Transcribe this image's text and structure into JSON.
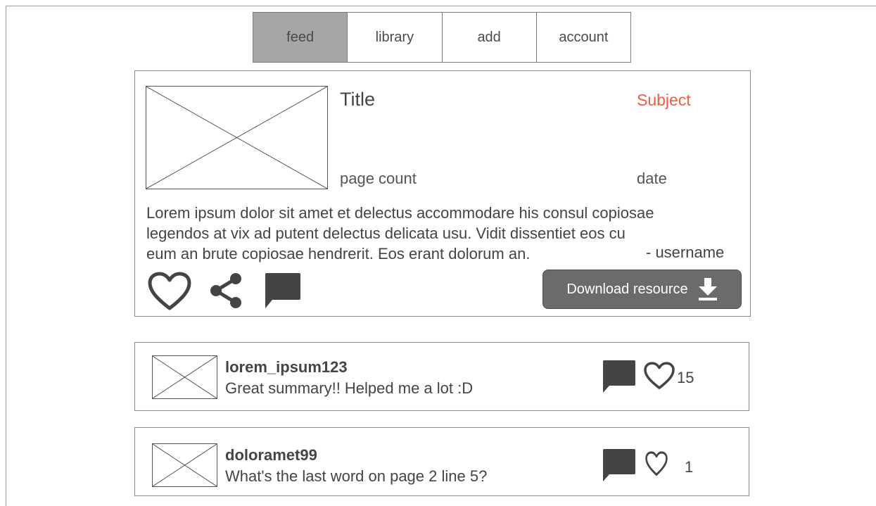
{
  "nav": {
    "tabs": [
      {
        "label": "feed",
        "active": true
      },
      {
        "label": "library",
        "active": false
      },
      {
        "label": "add",
        "active": false
      },
      {
        "label": "account",
        "active": false
      }
    ]
  },
  "resource": {
    "title": "Title",
    "subject": "Subject",
    "page_count": "page count",
    "date": "date",
    "description_lines": [
      "Lorem ipsum dolor sit amet et delectus accommodare his consul copiosae",
      "legendos at vix ad putent delectus delicata usu. Vidit dissentiet eos cu",
      "eum an brute copiosae hendrerit. Eos erant dolorum an."
    ],
    "username": "- username",
    "download_label": "Download resource",
    "icons": {
      "like": "heart-icon",
      "share": "share-icon",
      "comment": "comment-icon",
      "download": "download-icon"
    }
  },
  "comments": [
    {
      "username": "lorem_ipsum123",
      "text": "Great summary!! Helped me a lot :D",
      "likes": "15"
    },
    {
      "username": "doloramet99",
      "text": "What's the last word on page 2 line 5?",
      "likes": "1"
    }
  ],
  "colors": {
    "subject": "#f25c3f",
    "active_tab": "#a6a6a6",
    "download_button": "#6b6b6b",
    "icon": "#444444"
  }
}
